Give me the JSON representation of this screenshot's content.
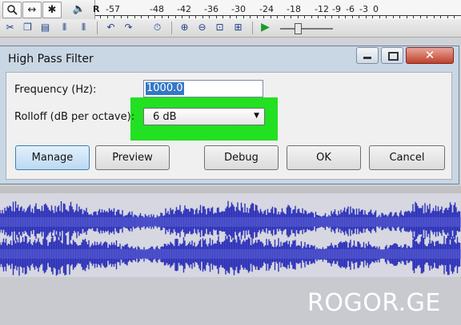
{
  "ruler": {
    "left_marker": "R",
    "labels": [
      "-57",
      "-48",
      "-42",
      "-36",
      "-30",
      "-24",
      "-18",
      "-12",
      "-9",
      "-6",
      "-3",
      "0"
    ]
  },
  "toolbar": {
    "tools": [
      "zoom-icon",
      "timeshift-icon",
      "multi-tool-icon",
      "volume-icon"
    ],
    "edit_tools": [
      "cut-icon",
      "copy-icon",
      "paste-icon",
      "trim-icon",
      "silence-icon",
      "undo-icon",
      "redo-icon",
      "sync-lock-icon",
      "zoom-in-icon",
      "zoom-out-icon",
      "fit-selection-icon",
      "fit-project-icon",
      "play-at-speed-icon"
    ]
  },
  "dialog": {
    "title": "High Pass Filter",
    "frequency_label": "Frequency (Hz):",
    "frequency_value": "1000.0",
    "rolloff_label": "Rolloff (dB per octave):",
    "rolloff_value": "6 dB",
    "highlight_color": "#22e022",
    "buttons": {
      "manage": "Manage",
      "preview": "Preview",
      "debug": "Debug",
      "ok": "OK",
      "cancel": "Cancel"
    }
  },
  "waveform": {
    "color": "#2a2fb8"
  },
  "watermark": "ROGOR.GE"
}
